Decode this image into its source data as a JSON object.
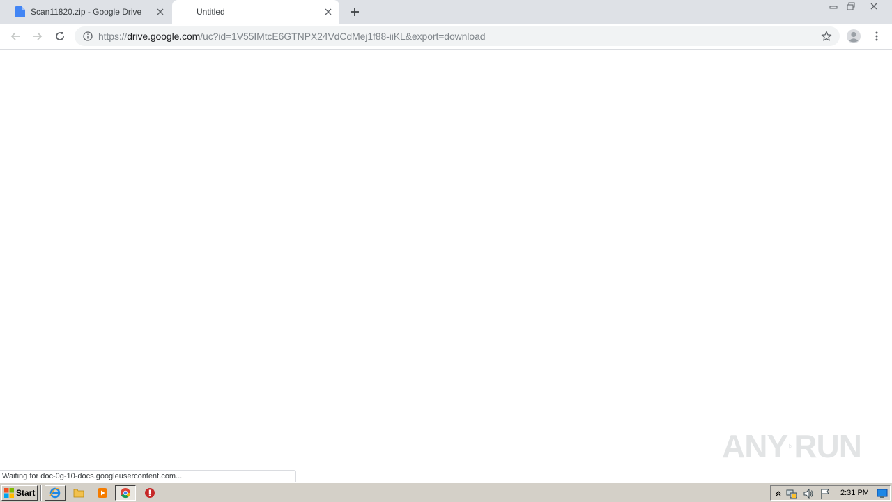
{
  "browser": {
    "tabs": [
      {
        "title": "Scan11820.zip - Google Drive",
        "favicon": "google-docs-file-icon",
        "active": false
      },
      {
        "title": "Untitled",
        "favicon": "none",
        "active": true
      }
    ],
    "url": {
      "scheme": "https://",
      "host": "drive.google.com",
      "path": "/uc?id=1V55IMtcE6GTNPX24VdCdMej1f88-iiKL&export=download"
    },
    "status_text": "Waiting for doc-0g-10-docs.googleusercontent.com..."
  },
  "watermark": {
    "left_text": "ANY",
    "right_text": "RUN"
  },
  "taskbar": {
    "start_label": "Start",
    "clock": "2:31 PM",
    "quick_launch": [
      "internet-explorer-icon",
      "folder-icon",
      "media-player-icon",
      "chrome-icon",
      "avg-icon"
    ]
  },
  "colors": {
    "tabstrip": "#dee1e6",
    "omnibox": "#f1f3f4",
    "taskbar": "#d4d0c8",
    "accent_blue": "#4285f4"
  }
}
